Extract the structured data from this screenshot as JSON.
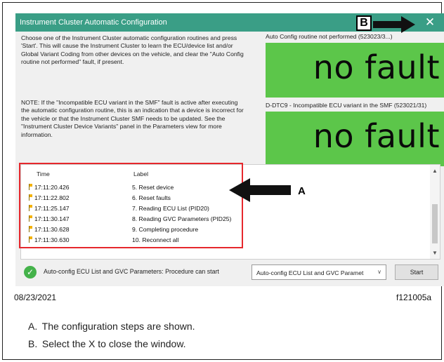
{
  "window": {
    "title": "Instrument Cluster Automatic Configuration",
    "close_glyph": "✕"
  },
  "instructions": {
    "paragraph1": "Choose one of the Instrument Cluster automatic configuration routines and press 'Start'. This will cause the Instrument Cluster to learn the ECU/device list and/or Global Variant Coding from other devices on the vehicle, and clear the \"Auto Config routine not performed\" fault, if present.",
    "paragraph2": "NOTE: If the \"Incompatible ECU variant in the SMF\" fault is active after executing the automatic configuration routine, this is an indication that a device is incorrect for the vehicle or that the Instrument Cluster SMF needs to be updated.  See the \"Instrument Cluster Device Variants\" panel in the Parameters view for more information."
  },
  "faults": [
    {
      "label": "Auto Config routine not performed (523023/3...)",
      "status": "no fault",
      "color": "#5cc64a"
    },
    {
      "label": "D-DTC9 - Incompatible ECU variant in the SMF (523021/31)",
      "status": "no fault",
      "color": "#5cc64a"
    }
  ],
  "log": {
    "columns": [
      "Time",
      "Label"
    ],
    "rows": [
      {
        "time": "17:11:20.426",
        "label": "5. Reset device"
      },
      {
        "time": "17:11:22.802",
        "label": "6. Reset faults"
      },
      {
        "time": "17:11:25.147",
        "label": "7. Reading ECU List (PID20)"
      },
      {
        "time": "17:11:30.147",
        "label": "8. Reading GVC Parameters (PID25)"
      },
      {
        "time": "17:11:30.628",
        "label": "9. Completing procedure"
      },
      {
        "time": "17:11:30.630",
        "label": "10. Reconnect all"
      }
    ]
  },
  "status_bar": {
    "message": "Auto-config ECU List and GVC Parameters: Procedure can start",
    "select_value": "Auto-config ECU List and GVC Paramet",
    "start_label": "Start"
  },
  "callouts": {
    "a": "A",
    "b": "B"
  },
  "footer": {
    "date": "08/23/2021",
    "figure_id": "f121005a"
  },
  "captions": [
    {
      "letter": "A.",
      "text": "The configuration steps are shown."
    },
    {
      "letter": "B.",
      "text": "Select the X to close the window."
    }
  ],
  "colors": {
    "titlebar": "#3a9e86",
    "fault_green": "#5cc64a",
    "highlight_red": "#e6282d"
  }
}
